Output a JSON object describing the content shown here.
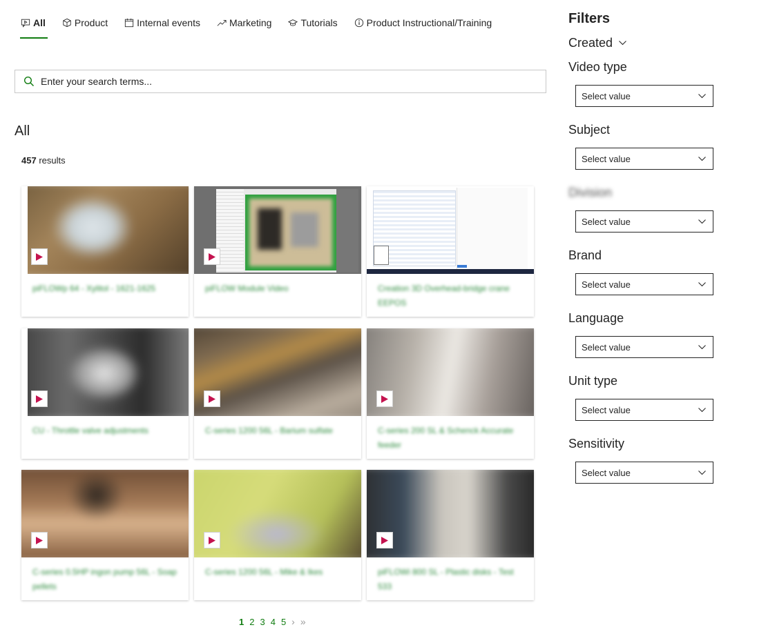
{
  "tabs": [
    {
      "label": "All",
      "icon": "chat-video-icon",
      "active": true
    },
    {
      "label": "Product",
      "icon": "cube-icon"
    },
    {
      "label": "Internal events",
      "icon": "calendar-icon"
    },
    {
      "label": "Marketing",
      "icon": "trend-up-icon"
    },
    {
      "label": "Tutorials",
      "icon": "graduation-cap-icon"
    },
    {
      "label": "Product Instructional/Training",
      "icon": "info-icon"
    }
  ],
  "search": {
    "placeholder": "Enter your search terms...",
    "value": ""
  },
  "section_title": "All",
  "results": {
    "count": "457",
    "label": " results"
  },
  "videos": [
    {
      "title": "piFLOWp 64 - Xylitol - 1621-1625"
    },
    {
      "title": "piFLOW Module Video"
    },
    {
      "title": "Creation 3D Overhead-bridge crane EEPOS"
    },
    {
      "title": "CU - Throttle valve adjustments"
    },
    {
      "title": "C-series 1200 56L - Barium sulfate"
    },
    {
      "title": "C-series 200 SL & Schenck Accurate feeder"
    },
    {
      "title": "C-series 0.5HP ingon pump 56L - Soap pellets"
    },
    {
      "title": "C-series 1200 56L - Mike & Ikes"
    },
    {
      "title": "piFLOWi 800 SL - Plastic disks - Test 533"
    }
  ],
  "pagination": {
    "pages": [
      "1",
      "2",
      "3",
      "4",
      "5"
    ],
    "current": "1",
    "next": "›",
    "last": "»"
  },
  "filters": {
    "title": "Filters",
    "created_label": "Created",
    "groups": [
      {
        "label": "Video type",
        "value": "Select value"
      },
      {
        "label": "Subject",
        "value": "Select value"
      },
      {
        "label": "Division",
        "value": "Select value"
      },
      {
        "label": "Brand",
        "value": "Select value"
      },
      {
        "label": "Language",
        "value": "Select value"
      },
      {
        "label": "Unit type",
        "value": "Select value"
      },
      {
        "label": "Sensitivity",
        "value": "Select value"
      }
    ]
  },
  "colors": {
    "accent": "#107c10",
    "link": "#2e8b3e",
    "play": "#c4134f"
  }
}
